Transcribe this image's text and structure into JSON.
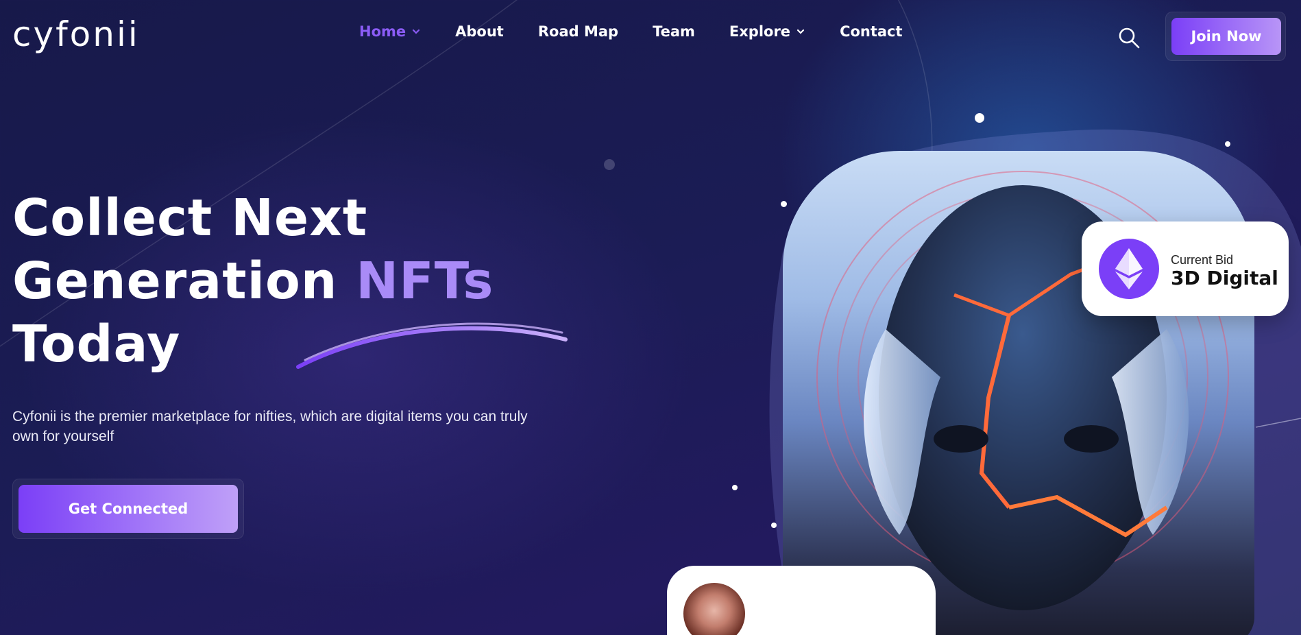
{
  "brand": {
    "logo_text": "cyfonii"
  },
  "nav": {
    "items": [
      {
        "label": "Home",
        "has_dropdown": true,
        "active": true
      },
      {
        "label": "About",
        "has_dropdown": false,
        "active": false
      },
      {
        "label": "Road Map",
        "has_dropdown": false,
        "active": false
      },
      {
        "label": "Team",
        "has_dropdown": false,
        "active": false
      },
      {
        "label": "Explore",
        "has_dropdown": true,
        "active": false
      },
      {
        "label": "Contact",
        "has_dropdown": false,
        "active": false
      }
    ],
    "search_icon": "search-icon",
    "join_label": "Join Now"
  },
  "hero": {
    "title_line1": "Collect Next",
    "title_line2_plain": "Generation ",
    "title_line2_accent": "NFTs",
    "title_line3": "Today",
    "description": "Cyfonii is the premier marketplace for nifties, which are digital items you can truly own for yourself",
    "cta_label": "Get Connected"
  },
  "bid_card": {
    "icon": "ethereum-icon",
    "label": "Current Bid",
    "value": "3D Digital"
  },
  "creator_card": {
    "avatar_icon": "creator-avatar"
  },
  "colors": {
    "accent": "#7b3ff7",
    "accent_light": "#a98bf7",
    "bg_dark": "#17194a",
    "white": "#ffffff"
  }
}
